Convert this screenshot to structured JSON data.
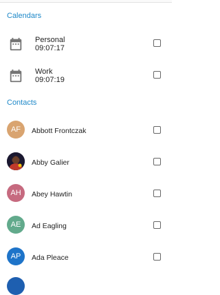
{
  "sections": {
    "calendars_title": "Calendars",
    "contacts_title": "Contacts"
  },
  "calendars": [
    {
      "name": "Personal",
      "time": "09:07:17",
      "checked": false
    },
    {
      "name": "Work",
      "time": "09:07:19",
      "checked": false
    }
  ],
  "contacts": [
    {
      "name": "Abbott Frontczak",
      "initials": "AF",
      "avatar_color": "#d9a470",
      "checked": false
    },
    {
      "name": "Abby Galier",
      "initials": "",
      "avatar_color": "#1a1a2e",
      "checked": false
    },
    {
      "name": "Abey Hawtin",
      "initials": "AH",
      "avatar_color": "#c66a7f",
      "checked": false
    },
    {
      "name": "Ad Eagling",
      "initials": "AE",
      "avatar_color": "#62aa8c",
      "checked": false
    },
    {
      "name": "Ada Pleace",
      "initials": "AP",
      "avatar_color": "#1e74c9",
      "checked": false
    }
  ],
  "colors": {
    "accent": "#1e88c8",
    "icon": "#757575",
    "checkbox": "#666666"
  }
}
